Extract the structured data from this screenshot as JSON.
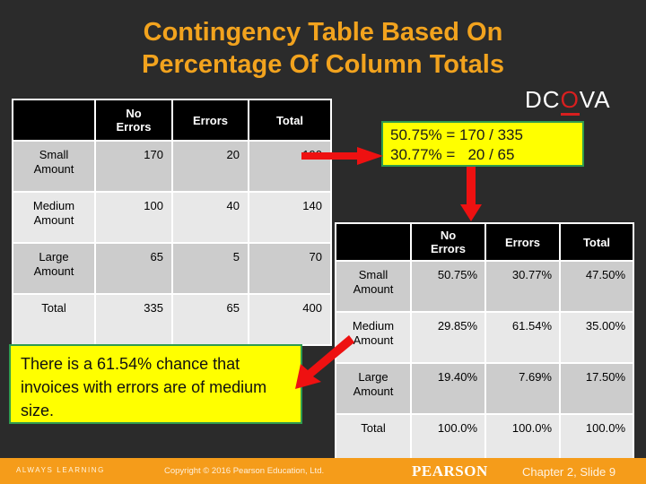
{
  "slide": {
    "title_line1": "Contingency Table Based On",
    "title_line2": "Percentage Of Column Totals",
    "title_color": "#f2a31e",
    "background_color": "#2b2b2b"
  },
  "dcova": {
    "prefix": "DC",
    "highlight": "O",
    "suffix": "VA",
    "highlight_color": "#d81f1f"
  },
  "counts_table": {
    "name": "contingency-counts-table",
    "headers": [
      "",
      "No\nErrors",
      "Errors",
      "Total"
    ],
    "header_col0": "",
    "header_col1_line1": "No",
    "header_col1_line2": "Errors",
    "header_col2": "Errors",
    "header_col3": "Total",
    "rows": [
      {
        "label_line1": "Small",
        "label_line2": "Amount",
        "no_errors": "170",
        "errors": "20",
        "total": "190"
      },
      {
        "label_line1": "Medium",
        "label_line2": "Amount",
        "no_errors": "100",
        "errors": "40",
        "total": "140"
      },
      {
        "label_line1": "Large",
        "label_line2": "Amount",
        "no_errors": "65",
        "errors": "5",
        "total": "70"
      },
      {
        "label_line1": "Total",
        "label_line2": "",
        "no_errors": "335",
        "errors": "65",
        "total": "400"
      }
    ]
  },
  "percent_table": {
    "name": "contingency-percent-table",
    "header_col0": "",
    "header_col1_line1": "No",
    "header_col1_line2": "Errors",
    "header_col2": "Errors",
    "header_col3": "Total",
    "rows": [
      {
        "label_line1": "Small",
        "label_line2": "Amount",
        "no_errors": "50.75%",
        "errors": "30.77%",
        "total": "47.50%"
      },
      {
        "label_line1": "Medium",
        "label_line2": "Amount",
        "no_errors": "29.85%",
        "errors": "61.54%",
        "total": "35.00%"
      },
      {
        "label_line1": "Large",
        "label_line2": "Amount",
        "no_errors": "19.40%",
        "errors": "7.69%",
        "total": "17.50%"
      },
      {
        "label_line1": "Total",
        "label_line2": "",
        "no_errors": "100.0%",
        "errors": "100.0%",
        "total": "100.0%"
      }
    ]
  },
  "calc_callout": {
    "line1": "50.75% = 170 / 335",
    "line2": "30.77% =   20 / 65",
    "fill_color": "#ffff00",
    "border_color": "#2f9b4f"
  },
  "statement_callout": {
    "text": "There is a 61.54% chance that invoices with errors are of medium size.",
    "fill_color": "#ffff00",
    "border_color": "#2f9b4f"
  },
  "arrows": {
    "color": "#ee1111",
    "horizontal_name": "arrow-to-calculation",
    "vertical_name": "arrow-to-percent-table",
    "diagonal_name": "arrow-to-statement"
  },
  "footer": {
    "always_learning": "ALWAYS LEARNING",
    "copyright": "Copyright © 2016 Pearson Education, Ltd.",
    "brand": "PEARSON",
    "chapter": "Chapter 2, Slide 9",
    "bar_color": "#f59c1a"
  }
}
